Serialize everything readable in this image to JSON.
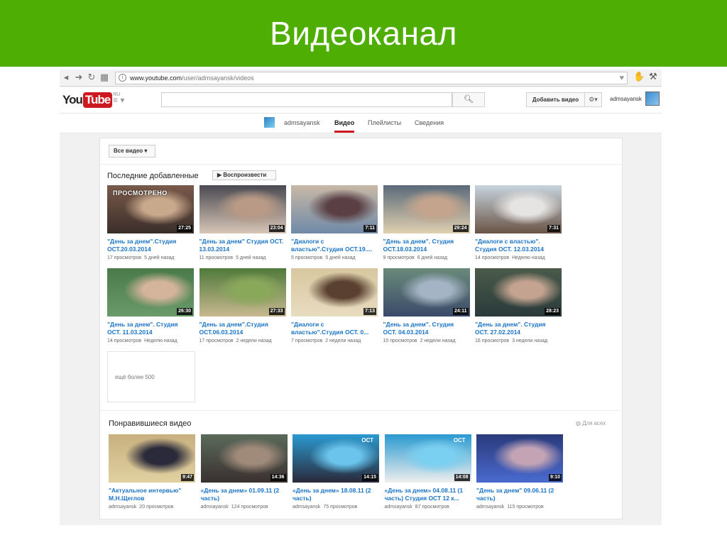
{
  "slide": {
    "title": "Видеоканал"
  },
  "browser": {
    "url_host": "www.youtube.com",
    "url_path": "/user/admsayansk/videos",
    "icons": [
      "back-arrow-icon",
      "forward-arrow-icon",
      "reload-icon",
      "apps-icon",
      "page-info-icon",
      "bookmark-star-icon",
      "extension-icon",
      "wrench-icon"
    ]
  },
  "youtube": {
    "logo_you": "You",
    "logo_tube": "Tube",
    "logo_region": "RU",
    "upload_label": "Добавить видео",
    "username": "admsayansk"
  },
  "channel_nav": {
    "channel_name": "admsayansk",
    "tabs": [
      "Видео",
      "Плейлисты",
      "Сведения"
    ]
  },
  "filter": {
    "label": "Все видео ▾"
  },
  "recent": {
    "title": "Последние добавленные",
    "play_all": "▶  Воспроизвести",
    "more_label": "ещё более 500",
    "videos": [
      {
        "title": "\"День за днем\".Студия ОСТ.20.03.2014",
        "views": "17 просмотров",
        "age": "5 дней назад",
        "duration": "27:25",
        "colors": [
          "#7a5a4a",
          "#c9a98c",
          "#3a2e2a"
        ],
        "watched": "ПРОСМОТРЕНО"
      },
      {
        "title": "\"День за днем\" Студия ОСТ. 13.03.2014",
        "views": "11 просмотров",
        "age": "5 дней назад",
        "duration": "23:04",
        "colors": [
          "#4a4a52",
          "#b89a86",
          "#d8c6b6"
        ]
      },
      {
        "title": "\"Диалоги с властью\".Студия ОСТ.19....",
        "views": "5 просмотров",
        "age": "5 дней назад",
        "duration": "7:11",
        "colors": [
          "#c8b8a6",
          "#5a3f44",
          "#6f8aa8"
        ]
      },
      {
        "title": "\"День за днем\". Студия ОСТ.18.03.2014",
        "views": "9 просмотров",
        "age": "6 дней назад",
        "duration": "29:24",
        "colors": [
          "#5a6a7a",
          "#c4a48c",
          "#e0d0b0"
        ]
      },
      {
        "title": "\"Диалоги с властью\". Студия ОСТ. 12.03.2014",
        "views": "14 просмотров",
        "age": "Неделю назад",
        "duration": "7:31",
        "colors": [
          "#c8d4de",
          "#e6e4e2",
          "#6a5446"
        ]
      },
      {
        "title": "\"День за днем\". Студия ОСТ. 11.03.2014",
        "views": "14 просмотров",
        "age": "Неделю назад",
        "duration": "26:30",
        "colors": [
          "#4a7a4a",
          "#d4b49a",
          "#6a9a6a"
        ]
      },
      {
        "title": "\"День за днем\".Студия ОСТ.06.03.2014",
        "views": "17 просмотров",
        "age": "2 недели назад",
        "duration": "27:33",
        "colors": [
          "#4f7a3a",
          "#8aa85a",
          "#c8b890"
        ]
      },
      {
        "title": "\"Диалоги с властью\".Студия ОСТ. 0...",
        "views": "7 просмотров",
        "age": "2 недели назад",
        "duration": "7:13",
        "colors": [
          "#d8c8a0",
          "#5a4030",
          "#e8dcc0"
        ]
      },
      {
        "title": "\"День за днем\". Студия ОСТ. 04.03.2014",
        "views": "15 просмотров",
        "age": "2 недели назад",
        "duration": "24:11",
        "colors": [
          "#6a8a7a",
          "#a4b4c4",
          "#3a4a6a"
        ]
      },
      {
        "title": "\"День за днем\". Студия ОСТ. 27.02.2014",
        "views": "16 просмотров",
        "age": "3 недели назад",
        "duration": "28:23",
        "colors": [
          "#4a5a4a",
          "#c4a490",
          "#2a3a3a"
        ]
      }
    ]
  },
  "liked": {
    "title": "Понравившиеся видео",
    "privacy": "Для всех",
    "videos": [
      {
        "title": "\"Актуальное интервью\" М.Н.Щеглов",
        "channel": "admsayansk",
        "views": "20 просмотров",
        "duration": "9:47",
        "colors": [
          "#c8b080",
          "#2a2a3a",
          "#e0d0a0"
        ]
      },
      {
        "title": "«День за днем» 01.09.11 (2 часть)",
        "channel": "admsayansk",
        "views": "124 просмотров",
        "duration": "14:36",
        "colors": [
          "#5a6a5a",
          "#a08a7a",
          "#3a3030"
        ]
      },
      {
        "title": "«День за днем» 18.08.11 (2 часть)",
        "channel": "admsayansk",
        "views": "75 просмотров",
        "duration": "14:15",
        "colors": [
          "#2a9ad0",
          "#6ac4ec",
          "#2a2a3a"
        ],
        "logo": "ОСТ"
      },
      {
        "title": "«День за днем» 04.08.11 (1 часть) Студия ОСТ 12 к...",
        "channel": "admsayansk",
        "views": "87 просмотров",
        "duration": "14:08",
        "colors": [
          "#2a9ad0",
          "#7ad0f0",
          "#eeeeee"
        ],
        "logo": "ОСТ"
      },
      {
        "title": "\"День за днем\" 09.06.11 (2 часть)",
        "channel": "admsayansk",
        "views": "115 просмотров",
        "duration": "9:10",
        "colors": [
          "#2a3a7a",
          "#c4a4b4",
          "#4a6ad0"
        ]
      }
    ]
  }
}
